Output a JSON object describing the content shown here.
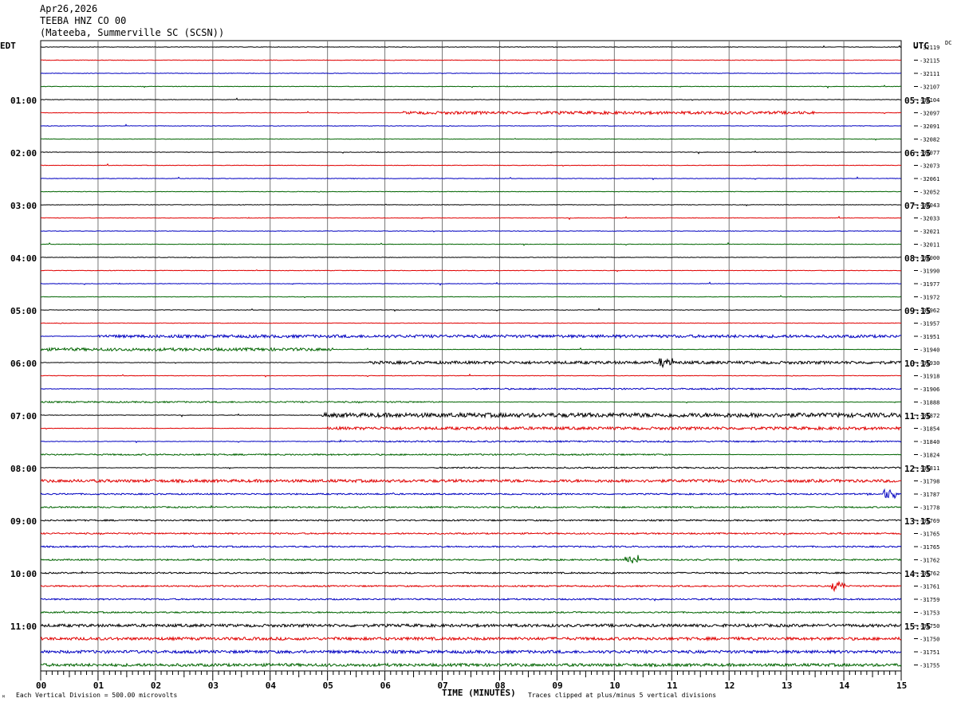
{
  "header": {
    "date": "Apr26,2026",
    "station": "TEEBA HNZ CO 00",
    "location": "(Mateeba, Summerville SC (SCSN))"
  },
  "left_tz": "EDT",
  "right_tz": "UTC",
  "dc_label": "DC",
  "footer": {
    "left_note": "Each Vertical Division =  500.00 microvolts",
    "right_note": "Traces clipped at plus/minus 5 vertical divisions",
    "corner_mark": "ᴹ"
  },
  "colors": [
    "#000000",
    "#e00000",
    "#0000c0",
    "#006400"
  ],
  "chart_data": {
    "type": "line",
    "xlabel": "TIME (MINUTES)",
    "x_ticks": [
      "00",
      "01",
      "02",
      "03",
      "04",
      "05",
      "06",
      "07",
      "08",
      "09",
      "10",
      "11",
      "12",
      "13",
      "14",
      "15"
    ],
    "xlim": [
      0,
      15
    ],
    "trace_interval_minutes": 15,
    "left_hour_labels": [
      "01:00",
      "02:00",
      "03:00",
      "04:00",
      "05:00",
      "06:00",
      "07:00",
      "08:00",
      "09:00",
      "10:00",
      "11:00"
    ],
    "right_hour_labels": [
      "05:15",
      "06:15",
      "07:15",
      "08:15",
      "09:15",
      "10:15",
      "11:15",
      "12:15",
      "13:15",
      "14:15",
      "15:15"
    ],
    "dc_offsets": [
      "-32119",
      "-32115",
      "-32111",
      "-32107",
      "-32104",
      "-32097",
      "-32091",
      "-32082",
      "-32077",
      "-32073",
      "-32061",
      "-32052",
      "-32043",
      "-32033",
      "-32021",
      "-32011",
      "-32000",
      "-31990",
      "-31977",
      "-31972",
      "-31962",
      "-31957",
      "-31951",
      "-31940",
      "-31930",
      "-31918",
      "-31906",
      "-31888",
      "-31872",
      "-31854",
      "-31840",
      "-31824",
      "-31811",
      "-31798",
      "-31787",
      "-31778",
      "-31769",
      "-31765",
      "-31765",
      "-31762",
      "-31762",
      "-31761",
      "-31759",
      "-31753",
      "-31750",
      "-31750",
      "-31751",
      "-31755"
    ],
    "activity": [
      {
        "trace": 5,
        "from": 6.3,
        "to": 13.5,
        "level": 2
      },
      {
        "trace": 22,
        "from": 1.0,
        "to": 15,
        "level": 2
      },
      {
        "trace": 23,
        "from": 0,
        "to": 5.1,
        "level": 2
      },
      {
        "trace": 24,
        "from": 5.7,
        "to": 15,
        "level": 2
      },
      {
        "trace": 26,
        "from": 7.5,
        "to": 15,
        "level": 1
      },
      {
        "trace": 27,
        "from": 0,
        "to": 7.0,
        "level": 1
      },
      {
        "trace": 28,
        "from": 4.9,
        "to": 15,
        "level": 3
      },
      {
        "trace": 29,
        "from": 5.0,
        "to": 15,
        "level": 2
      },
      {
        "trace": 30,
        "from": 5.0,
        "to": 15,
        "level": 1
      },
      {
        "trace": 31,
        "from": 0,
        "to": 11.0,
        "level": 1
      },
      {
        "trace": 32,
        "from": 6.9,
        "to": 15,
        "level": 1
      },
      {
        "trace": 33,
        "from": 0,
        "to": 15,
        "level": 2
      },
      {
        "trace": 34,
        "from": 0,
        "to": 15,
        "level": 1
      },
      {
        "trace": 35,
        "from": 0,
        "to": 15,
        "level": 1
      },
      {
        "trace": 36,
        "from": 0,
        "to": 15,
        "level": 1
      },
      {
        "trace": 37,
        "from": 0,
        "to": 15,
        "level": 1
      },
      {
        "trace": 38,
        "from": 0,
        "to": 15,
        "level": 1
      },
      {
        "trace": 39,
        "from": 0,
        "to": 15,
        "level": 1
      },
      {
        "trace": 40,
        "from": 0,
        "to": 15,
        "level": 1
      },
      {
        "trace": 41,
        "from": 0,
        "to": 15,
        "level": 1
      },
      {
        "trace": 42,
        "from": 0,
        "to": 15,
        "level": 1
      },
      {
        "trace": 43,
        "from": 0,
        "to": 15,
        "level": 1
      },
      {
        "trace": 44,
        "from": 0,
        "to": 15,
        "level": 2
      },
      {
        "trace": 45,
        "from": 0,
        "to": 15,
        "level": 2
      },
      {
        "trace": 46,
        "from": 0,
        "to": 15,
        "level": 2
      },
      {
        "trace": 47,
        "from": 0,
        "to": 15,
        "level": 2
      }
    ],
    "events": [
      {
        "trace": 24,
        "at": 10.9,
        "level": 4
      },
      {
        "trace": 39,
        "at": 10.3,
        "level": 4
      },
      {
        "trace": 41,
        "at": 13.9,
        "level": 4
      },
      {
        "trace": 34,
        "at": 14.8,
        "level": 4
      }
    ]
  }
}
